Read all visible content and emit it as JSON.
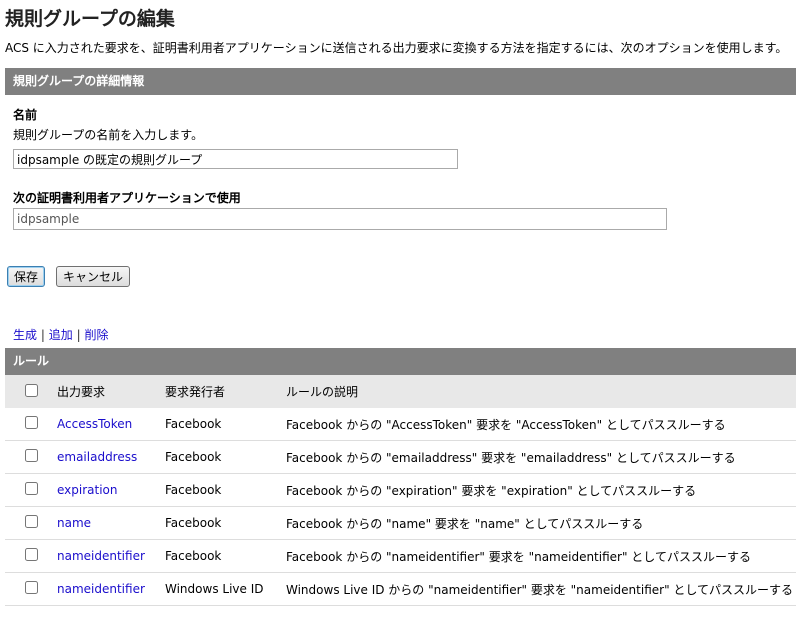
{
  "title": "規則グループの編集",
  "description": "ACS に入力された要求を、証明書利用者アプリケーションに送信される出力要求に変換する方法を指定するには、次のオプションを使用します。",
  "details": {
    "header": "規則グループの詳細情報",
    "name_label": "名前",
    "name_help": "規則グループの名前を入力します。",
    "name_value": "idpsample の既定の規則グループ",
    "rp_label": "次の証明書利用者アプリケーションで使用",
    "rp_value": "idpsample"
  },
  "buttons": {
    "save": "保存",
    "cancel": "キャンセル"
  },
  "actions": {
    "generate": "生成",
    "add": "追加",
    "delete": "削除",
    "sep": "|"
  },
  "rules": {
    "header": "ルール",
    "columns": [
      "出力要求",
      "要求発行者",
      "ルールの説明"
    ],
    "rows": [
      {
        "output": "AccessToken",
        "issuer": "Facebook",
        "desc": "Facebook からの \"AccessToken\" 要求を \"AccessToken\" としてパススルーする"
      },
      {
        "output": "emailaddress",
        "issuer": "Facebook",
        "desc": "Facebook からの \"emailaddress\" 要求を \"emailaddress\" としてパススルーする"
      },
      {
        "output": "expiration",
        "issuer": "Facebook",
        "desc": "Facebook からの \"expiration\" 要求を \"expiration\" としてパススルーする"
      },
      {
        "output": "name",
        "issuer": "Facebook",
        "desc": "Facebook からの \"name\" 要求を \"name\" としてパススルーする"
      },
      {
        "output": "nameidentifier",
        "issuer": "Facebook",
        "desc": "Facebook からの \"nameidentifier\" 要求を \"nameidentifier\" としてパススルーする"
      },
      {
        "output": "nameidentifier",
        "issuer": "Windows Live ID",
        "desc": "Windows Live ID からの \"nameidentifier\" 要求を \"nameidentifier\" としてパススルーする"
      }
    ]
  }
}
